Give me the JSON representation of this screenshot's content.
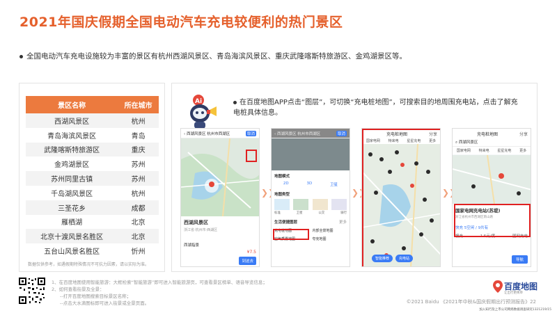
{
  "title": "2021年国庆假期全国电动汽车充电较便利的热门景区",
  "intro_bullet": "全国电动汽车充电设施较为丰富的景区有杭州西湖风景区、青岛海滨风景区、重庆武隆喀斯特旅游区、金鸡湖景区等。",
  "table": {
    "headers": [
      "景区名称",
      "所在城市"
    ],
    "rows": [
      [
        "西湖风景区",
        "杭州"
      ],
      [
        "青岛海滨风景区",
        "青岛"
      ],
      [
        "武隆喀斯特旅游区",
        "重庆"
      ],
      [
        "金鸡湖景区",
        "苏州"
      ],
      [
        "苏州同里古镇",
        "苏州"
      ],
      [
        "千岛湖风景区",
        "杭州"
      ],
      [
        "三圣花乡",
        "成都"
      ],
      [
        "雁栖湖",
        "北京"
      ],
      [
        "北京十渡风景名胜区",
        "北京"
      ],
      [
        "五台山风景名胜区",
        "忻州"
      ]
    ],
    "note": "数据仅供参考，如遇假期特殊情况不可抗力因素，请以实际为准。"
  },
  "right_bullet": "在百度地图APP点击“图层”，可切换“充电桩地图”，可搜索目的地周围充电站，点击了解充电桩具体信息。",
  "phones": {
    "p1": {
      "search": "西湖风景区 杭州市西湖区",
      "cancel": "取消",
      "place_name": "西湖风景区",
      "place_sub": "浙江省·杭州市·西湖区",
      "tab": "西湖指景",
      "price": "¥7.5",
      "btn": "到这去"
    },
    "p2": {
      "search": "西湖风景区 杭州市西湖区",
      "cancel": "取消",
      "layer_title": "地图模式",
      "modes": [
        "2D",
        "3D",
        "卫星"
      ],
      "types_title": "地图类型",
      "types": [
        "标准",
        "卫星",
        "公交",
        "骑行"
      ],
      "service_title": "生活便捷图层",
      "more": "更多",
      "services": [
        "充电桩地图",
        "内部全景地图",
        "空气质量地图",
        "夸克地图"
      ]
    },
    "p3": {
      "title": "充电桩地图",
      "share": "分享",
      "filters": [
        "国家电网",
        "特来电",
        "星星充电",
        "更多"
      ],
      "actions": [
        "智能推荐",
        "充电站"
      ]
    },
    "p4": {
      "title": "充电桩地图",
      "share": "分享",
      "search": "西湖风景区",
      "filters": [
        "国家电网",
        "特来电",
        "星星充电",
        "更多"
      ],
      "station_name": "国家电网充电站(苏堤)",
      "station_addr": "浙江省杭州市西湖区南山路",
      "fast_label": "快充",
      "fast_value": "5空闲 / 9共有",
      "slow_label": "慢充",
      "price": "1.5元/度",
      "tag": "国网充电",
      "btn": "导航"
    }
  },
  "notes": {
    "line1": "1、在百度地图使用智能旅游：大框检索“智能旅游”即可进入智能旅游页，可查看景区榜单、语音导览信息；",
    "line2": "2、如何查看街景及全景：",
    "line3": "--打开百度地图搜索目标景区名称；",
    "line4": "--点击大水滴图标即可进入街景或全景页面。"
  },
  "footer": "©2021 Baidu 《2021年中秋&国庆假期出行预测报告》22",
  "logo": "百度地图",
  "logo_sub": "让出行更简单",
  "id_line": "加入知行及上市公司网络数据调查研究1321219/15"
}
